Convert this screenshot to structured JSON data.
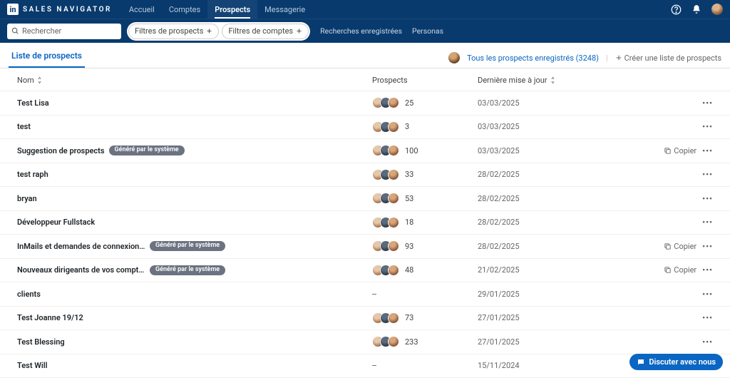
{
  "brand": "SALES NAVIGATOR",
  "nav": {
    "home": "Accueil",
    "accounts": "Comptes",
    "prospects": "Prospects",
    "messaging": "Messagerie"
  },
  "search": {
    "placeholder": "Rechercher"
  },
  "filters": {
    "prospects": "Filtres de prospects",
    "accounts": "Filtres de comptes",
    "saved": "Recherches enregistrées",
    "personas": "Personas"
  },
  "tabs": {
    "list": "Liste de prospects"
  },
  "saved_all": "Tous les prospects enregistrés (3248)",
  "create_list": "Créer une liste de prospects",
  "columns": {
    "name": "Nom",
    "prospects": "Prospects",
    "updated": "Dernière mise à jour"
  },
  "badge_system": "Généré par le système",
  "copy": "Copier",
  "chat": "Discuter avec nous",
  "rows": [
    {
      "name": "Test Lisa",
      "badge": false,
      "count": "25",
      "date": "03/03/2025",
      "copy": false,
      "faces": true
    },
    {
      "name": "test",
      "badge": false,
      "count": "3",
      "date": "03/03/2025",
      "copy": false,
      "faces": true
    },
    {
      "name": "Suggestion de prospects",
      "badge": true,
      "count": "100",
      "date": "03/03/2025",
      "copy": true,
      "faces": true
    },
    {
      "name": "test raph",
      "badge": false,
      "count": "33",
      "date": "28/02/2025",
      "copy": false,
      "faces": true
    },
    {
      "name": "bryan",
      "badge": false,
      "count": "53",
      "date": "28/02/2025",
      "copy": false,
      "faces": true
    },
    {
      "name": "Développeur Fullstack",
      "badge": false,
      "count": "18",
      "date": "28/02/2025",
      "copy": false,
      "faces": true
    },
    {
      "name": "InMails et demandes de connexion acceptés r…",
      "badge": true,
      "count": "93",
      "date": "28/02/2025",
      "copy": true,
      "faces": true
    },
    {
      "name": "Nouveaux dirigeants de vos comptes enregist…",
      "badge": true,
      "count": "48",
      "date": "21/02/2025",
      "copy": true,
      "faces": true
    },
    {
      "name": "clients",
      "badge": false,
      "count": "--",
      "date": "29/01/2025",
      "copy": false,
      "faces": false
    },
    {
      "name": "Test Joanne 19/12",
      "badge": false,
      "count": "73",
      "date": "27/01/2025",
      "copy": false,
      "faces": true
    },
    {
      "name": "Test Blessing",
      "badge": false,
      "count": "233",
      "date": "27/01/2025",
      "copy": false,
      "faces": true
    },
    {
      "name": "Test Will",
      "badge": false,
      "count": "--",
      "date": "15/11/2024",
      "copy": false,
      "faces": false
    }
  ]
}
